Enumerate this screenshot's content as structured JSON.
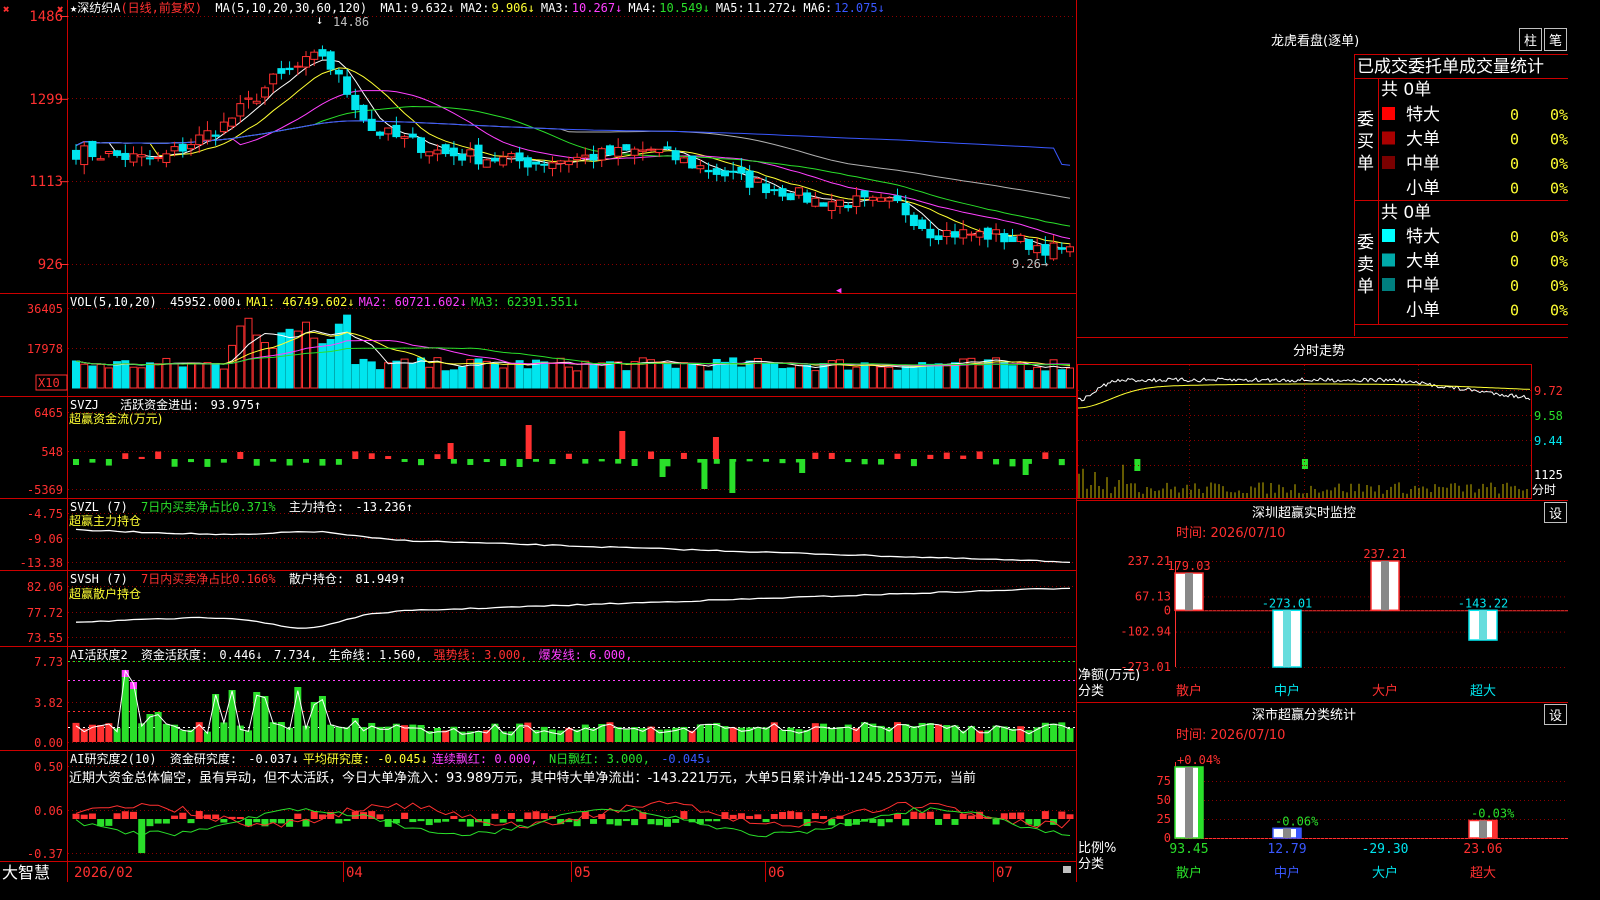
{
  "app_name": "大智慧",
  "colors": {
    "bg": "#000000",
    "grid": "#8b0000",
    "frame": "#cc0000",
    "axis": "#ff3030",
    "up": "#ff3030",
    "down": "#00e5ee",
    "green": "#2adf2a",
    "yellow": "#ffff33",
    "magenta": "#ff40ff",
    "white": "#ffffff",
    "blue": "#3a58ff",
    "gray": "#b0b0b0"
  },
  "price": {
    "stock": "★深纺织A",
    "mode": "(日线,前复权)",
    "ma_label": "MA(5,10,20,30,60,120)",
    "ma": [
      {
        "label": "MA1:",
        "value": "9.632↓",
        "color": "#ffffff"
      },
      {
        "label": "MA2:",
        "value": "9.906↓",
        "color": "#ffff33"
      },
      {
        "label": "MA3:",
        "value": "10.267↓",
        "color": "#ff40ff"
      },
      {
        "label": "MA4:",
        "value": "10.549↓",
        "color": "#2adf2a"
      },
      {
        "label": "MA5:",
        "value": "11.272↓",
        "color": "#ffffff"
      },
      {
        "label": "MA6:",
        "value": "12.075↓",
        "color": "#3a58ff"
      }
    ],
    "y_ticks": [
      "1486",
      "1299",
      "1113",
      "926"
    ],
    "y_values": [
      14.86,
      12.99,
      11.13,
      9.26
    ],
    "high_note": "14.86",
    "low_note": "9.26→",
    "high": 14.86,
    "low": 9.26,
    "start": 11.8,
    "end": 9.55
  },
  "vol": {
    "label": "VOL(5,10,20)",
    "value": "45952.000↓",
    "ma1": "MA1: 46749.602↓",
    "ma2": "MA2: 60721.602↓",
    "ma3": "MA3: 62391.551↓",
    "y_ticks": [
      "36405",
      "17978"
    ],
    "unit": "X10"
  },
  "svzj": {
    "name": "SVZJ",
    "label": "活跃资金进出:",
    "value": "93.975↑",
    "sub": "超赢资金流(万元)",
    "y_ticks": [
      "6465",
      "548",
      "-5369"
    ]
  },
  "svzl": {
    "name": "SVZL (7)",
    "label": "7日内买卖净占比0.371%",
    "label2": "主力持仓:",
    "value": "-13.236↑",
    "sub": "超赢主力持仓",
    "y_ticks": [
      "-4.75",
      "-9.06",
      "-13.38"
    ]
  },
  "svsh": {
    "name": "SVSH (7)",
    "label": "7日内买卖净占比0.166%",
    "label2": "散户持仓:",
    "value": "81.949↑",
    "sub": "超赢散户持仓",
    "y_ticks": [
      "82.06",
      "77.72",
      "73.55"
    ]
  },
  "ai_active": {
    "name": "AI活跃度2",
    "label": "资金活跃度:",
    "value": "0.446↓",
    "value2": "7.734,",
    "life": "生命线: 1.560,",
    "strong": "强势线: 3.000,",
    "burst": "爆发线: 6.000,",
    "y_ticks": [
      "7.73",
      "3.82",
      "0.00"
    ]
  },
  "ai_research": {
    "name": "AI研究度2(10)",
    "label": "资金研究度:",
    "value": "-0.037↓",
    "avg": "平均研究度: -0.045↓",
    "red": "连续飘红: 0.000,",
    "nred": "N日飘红: 3.000,",
    "last": "-0.045↓",
    "desc": "近期大资金总体偏空，虽有异动，但不太活跃，今日大单净流入：93.989万元，其中特大单净流出：-143.221万元，大单5日累计净出-1245.253万元，当前",
    "y_ticks": [
      "0.50",
      "0.06",
      "-0.37"
    ]
  },
  "xaxis": {
    "labels": [
      "2026/02",
      "04",
      "05",
      "06",
      "07"
    ]
  },
  "right": {
    "dragon_title": "龙虎看盘(逐单)",
    "btn_zhu": "柱",
    "btn_bi": "笔",
    "order_title": "已成交委托单成交量统计",
    "buy_label": "委买单",
    "sell_label": "委卖单",
    "buy_total": "共 0单",
    "sell_total": "共 0单",
    "buy_rows": [
      {
        "name": "特大",
        "n": "0",
        "pct": "0%",
        "color": "#ff0000"
      },
      {
        "name": "大单",
        "n": "0",
        "pct": "0%",
        "color": "#aa0000"
      },
      {
        "name": "中单",
        "n": "0",
        "pct": "0%",
        "color": "#7a0000"
      },
      {
        "name": "小单",
        "n": "0",
        "pct": "0%",
        "color": ""
      }
    ],
    "sell_rows": [
      {
        "name": "特大",
        "n": "0",
        "pct": "0%",
        "color": "#00ffff"
      },
      {
        "name": "大单",
        "n": "0",
        "pct": "0%",
        "color": "#00aaaa"
      },
      {
        "name": "中单",
        "n": "0",
        "pct": "0%",
        "color": "#007f7f"
      },
      {
        "name": "小单",
        "n": "0",
        "pct": "0%",
        "color": ""
      }
    ],
    "intraday_title": "分时走势",
    "intraday_ticks": [
      "9.72",
      "9.58",
      "9.44"
    ],
    "intraday_vol": "1125",
    "intraday_unit": "分时",
    "monitor_title": "深圳超赢实时监控",
    "set": "设",
    "monitor_time": "时间: 2026/07/10",
    "monitor_ticks": [
      "237.21",
      "67.13",
      "0",
      "-102.94",
      "-273.01"
    ],
    "monitor_unit1": "净额(万元)",
    "monitor_unit2": "分类",
    "monitor_bars": [
      {
        "cat": "散户",
        "value": 179.03,
        "label": "179.03"
      },
      {
        "cat": "中户",
        "value": -273.01,
        "label": "-273.01"
      },
      {
        "cat": "大户",
        "value": 237.21,
        "label": "237.21"
      },
      {
        "cat": "超大",
        "value": -143.22,
        "label": "-143.22"
      }
    ],
    "stats_title": "深市超赢分类统计",
    "stats_time": "时间: 2026/07/10",
    "stats_ticks": [
      "75",
      "50",
      "25",
      "0"
    ],
    "stats_unit1": "比例%",
    "stats_unit2": "分类",
    "stats_bars": [
      {
        "cat": "散户",
        "value": 93.45,
        "label": "93.45",
        "top": "+0.04%"
      },
      {
        "cat": "中户",
        "value": 12.79,
        "label": "12.79",
        "top": "-0.06%"
      },
      {
        "cat": "大户",
        "value": -29.3,
        "label": "-29.30",
        "top": ""
      },
      {
        "cat": "超大",
        "value": 23.06,
        "label": "23.06",
        "top": "-0.03%"
      }
    ]
  }
}
